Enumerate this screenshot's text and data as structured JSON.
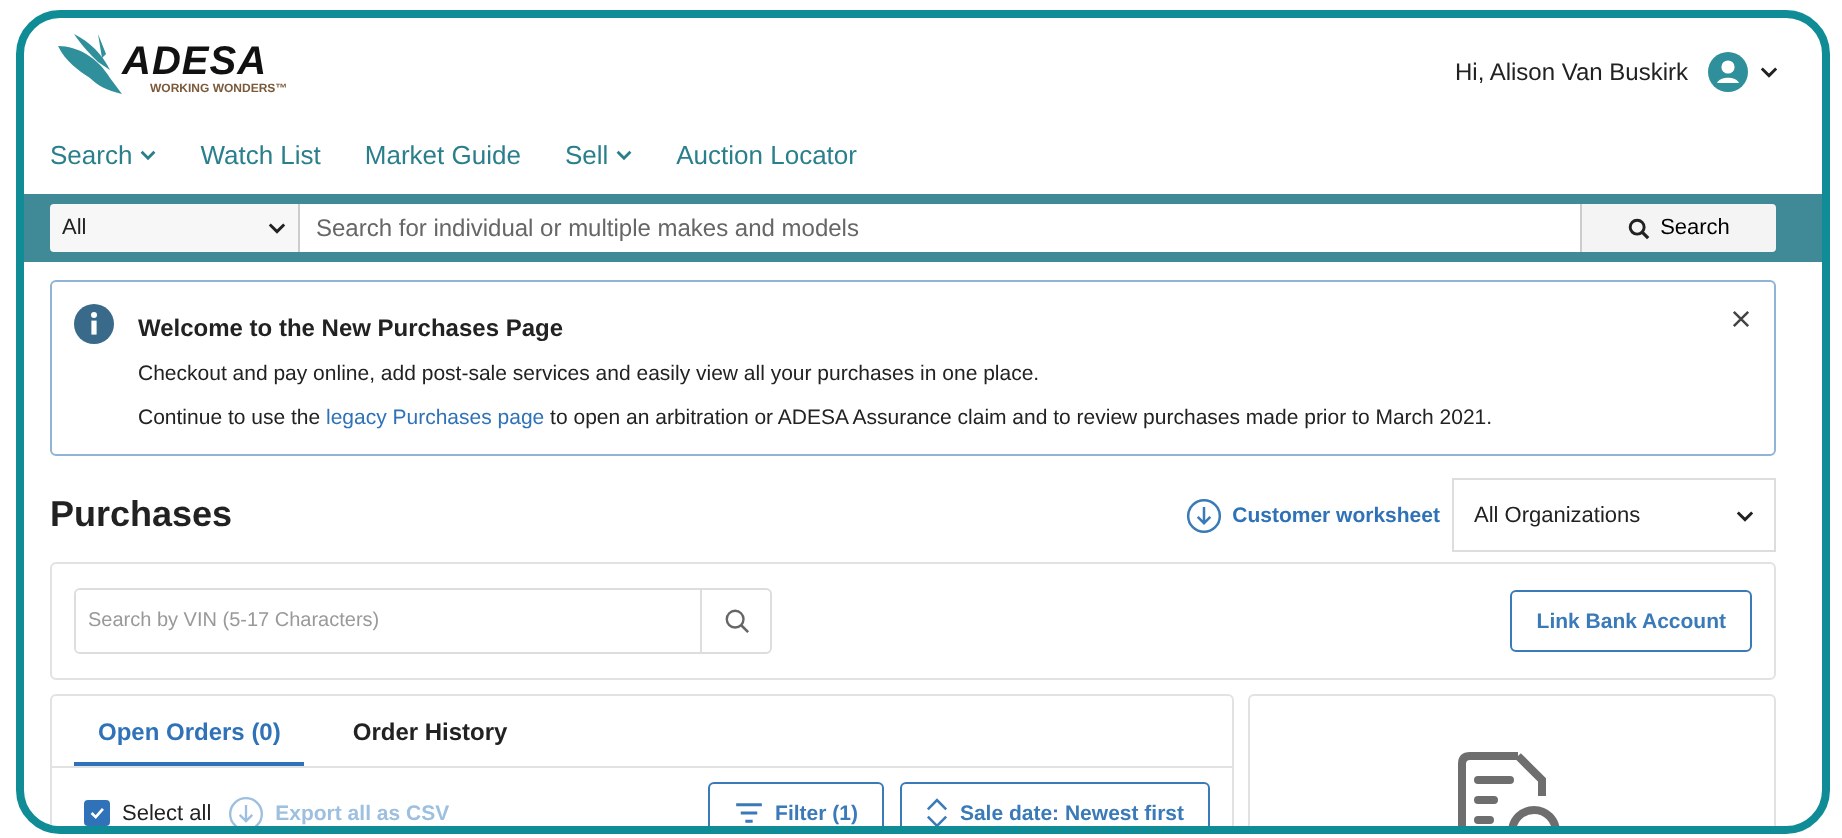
{
  "header": {
    "logo": {
      "name": "ADESA",
      "tagline": "WORKING WONDERS™"
    },
    "greeting": "Hi, Alison Van Buskirk"
  },
  "nav": [
    {
      "label": "Search",
      "dropdown": true
    },
    {
      "label": "Watch List",
      "dropdown": false
    },
    {
      "label": "Market Guide",
      "dropdown": false
    },
    {
      "label": "Sell",
      "dropdown": true
    },
    {
      "label": "Auction Locator",
      "dropdown": false
    }
  ],
  "search_bar": {
    "category": "All",
    "placeholder": "Search for individual or multiple makes and models",
    "button": "Search"
  },
  "notice": {
    "title": "Welcome to the New Purchases Page",
    "text": "Checkout and pay online, add post-sale services and easily view all your purchases in one place.",
    "before_link": "Continue to use the",
    "link": "legacy Purchases page",
    "after_link": "to open an arbitration or ADESA Assurance claim and to review purchases made prior to March 2021."
  },
  "page": {
    "title": "Purchases",
    "worksheet_link": "Customer worksheet",
    "organization": "All Organizations"
  },
  "vin_search": {
    "placeholder": "Search by VIN (5-17 Characters)"
  },
  "link_bank_button": "Link Bank Account",
  "tabs": [
    {
      "label": "Open Orders (0)",
      "selected": true
    },
    {
      "label": "Order History",
      "selected": false
    }
  ],
  "toolbar": {
    "select_all": {
      "label": "Select all",
      "checked": true
    },
    "export": {
      "label": "Export all as CSV",
      "disabled": true
    },
    "filter": "Filter (1)",
    "sort": "Sale date: Newest first"
  }
}
